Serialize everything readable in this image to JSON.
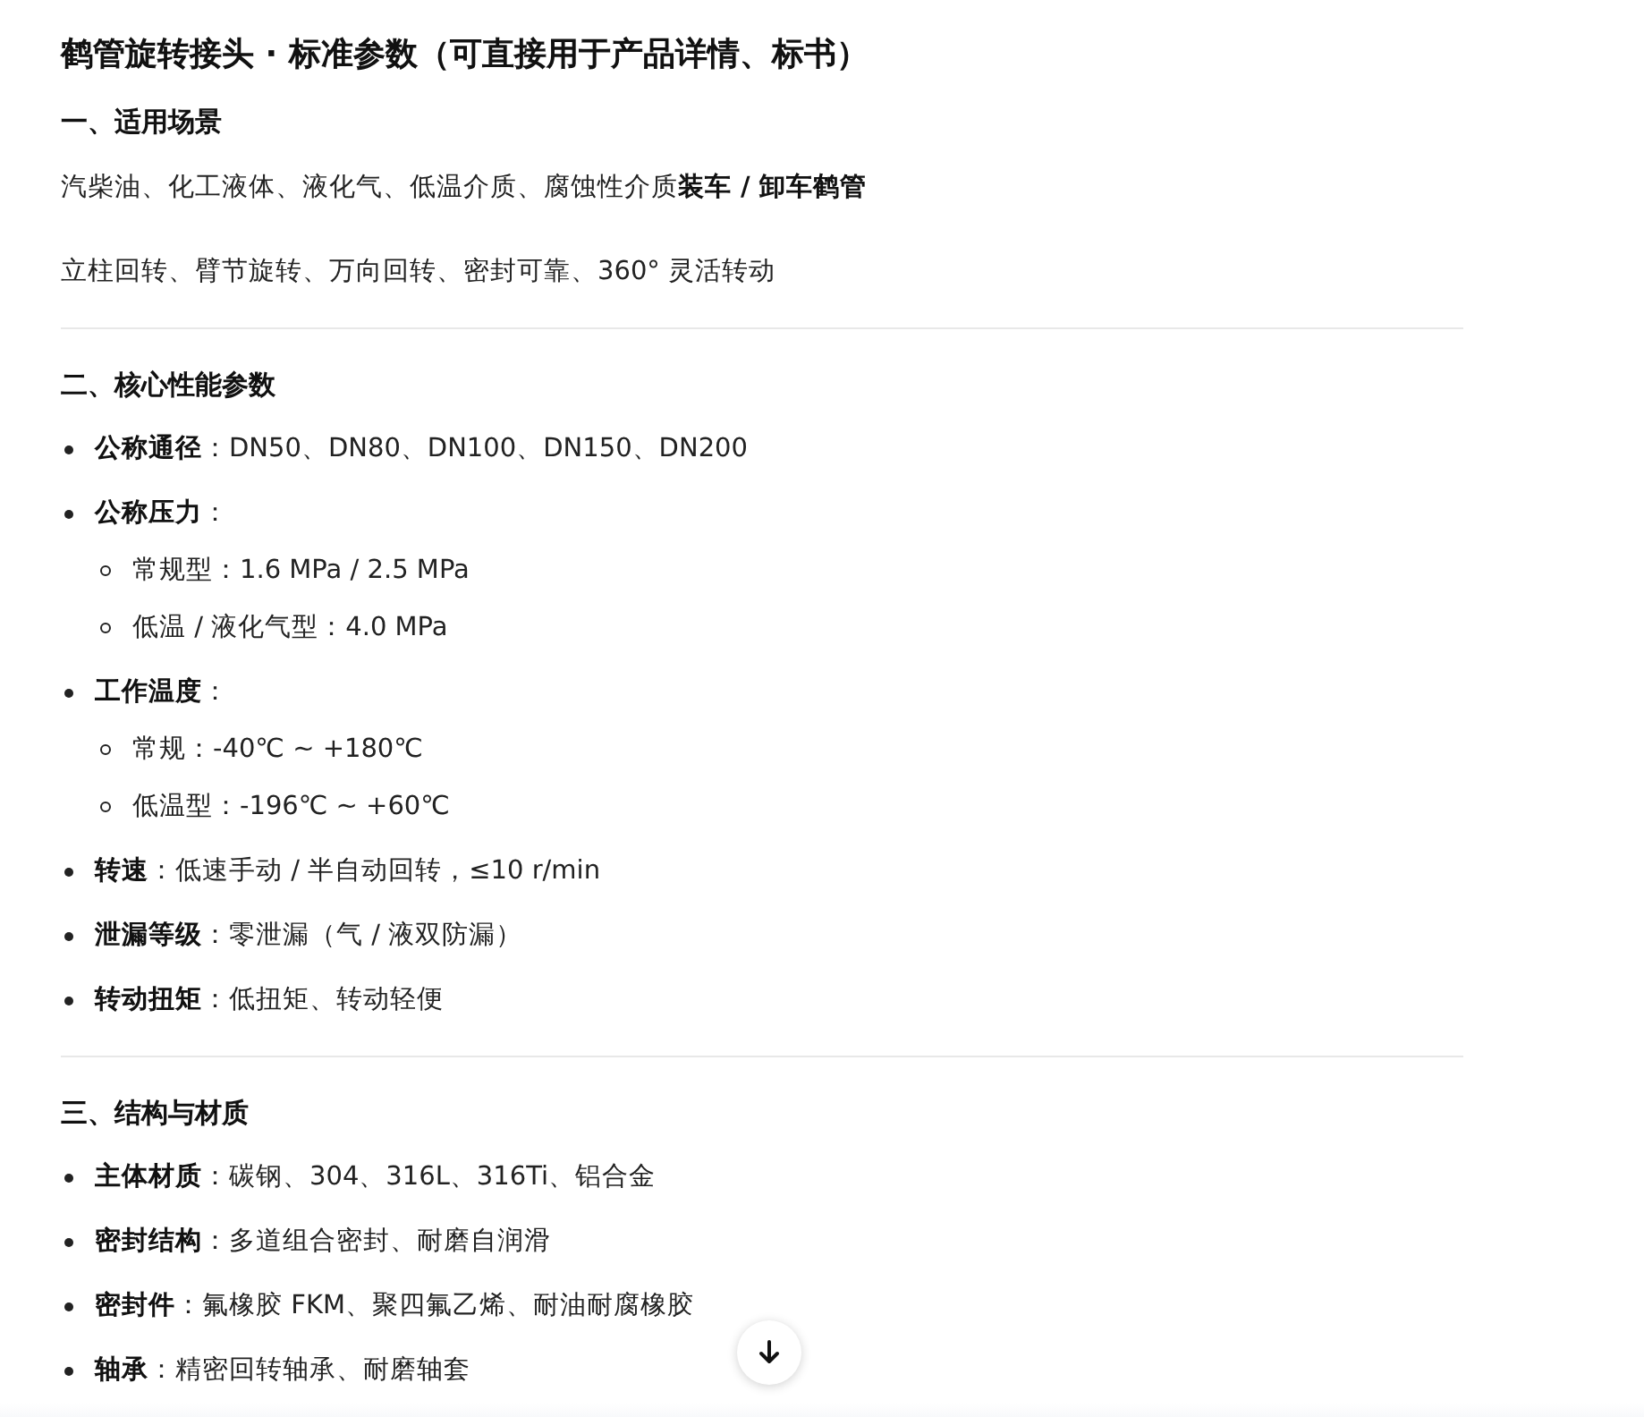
{
  "title": "鹤管旋转接头 · 标准参数（可直接用于产品详情、标书）",
  "sections": [
    {
      "heading": "一、适用场景",
      "paragraphs": [
        "汽柴油、化工液体、液化气、低温介质、腐蚀性介质**装车 / 卸车鹤管**",
        "立柱回转、臂节旋转、万向回转、密封可靠、360° 灵活转动"
      ]
    },
    {
      "heading": "二、核心性能参数",
      "items": [
        {
          "text": "**公称通径**：DN50、DN80、DN100、DN150、DN200"
        },
        {
          "text": "**公称压力**：",
          "children": [
            "常规型：1.6 MPa / 2.5 MPa",
            "低温 / 液化气型：4.0 MPa"
          ]
        },
        {
          "text": "**工作温度**：",
          "children": [
            "常规：-40℃ ~ +180℃",
            "低温型：-196℃ ~ +60℃"
          ]
        },
        {
          "text": "**转速**：低速手动 / 半自动回转，≤10 r/min"
        },
        {
          "text": "**泄漏等级**：零泄漏（气 / 液双防漏）"
        },
        {
          "text": "**转动扭矩**：低扭矩、转动轻便"
        }
      ]
    },
    {
      "heading": "三、结构与材质",
      "items": [
        {
          "text": "**主体材质**：碳钢、304、316L、316Ti、铝合金"
        },
        {
          "text": "**密封结构**：多道组合密封、耐磨自润滑"
        },
        {
          "text": "**密封件**：氟橡胶 FKM、聚四氟乙烯、耐油耐腐橡胶"
        },
        {
          "text": "**轴承**：精密回转轴承、耐磨轴套"
        }
      ]
    }
  ]
}
